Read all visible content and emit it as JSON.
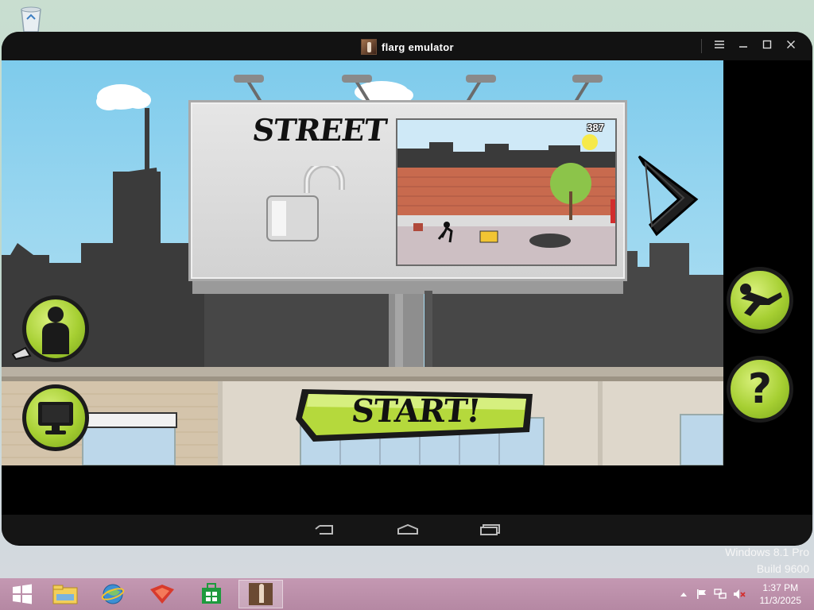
{
  "window": {
    "title": "flarg emulator",
    "controls": [
      "menu-icon",
      "minimize-icon",
      "maximize-icon",
      "close-icon"
    ]
  },
  "game": {
    "mode_title": "STREET",
    "mode_locked": false,
    "preview_score": "387",
    "start_label": "START!",
    "buttons": [
      "character-icon",
      "tv-icon",
      "trick-icon",
      "help-icon",
      "next-arrow-icon"
    ],
    "help_symbol": "?"
  },
  "android_nav": [
    "back-icon",
    "home-icon",
    "recents-icon"
  ],
  "desktop": {
    "watermark_line1": "Windows 8.1 Pro",
    "watermark_line2": "Build 9600"
  },
  "taskbar": {
    "items": [
      "windows-start-icon",
      "file-explorer-icon",
      "browser-icon",
      "app-fox-icon",
      "store-icon",
      "flarg-emulator-icon"
    ],
    "time": "1:37 PM",
    "date": "11/3/2025"
  },
  "colors": {
    "accent_green": "#a6cf32",
    "sky": "#8fd2ef",
    "titlebar": "#121212",
    "taskbar": "#bd8fab"
  }
}
